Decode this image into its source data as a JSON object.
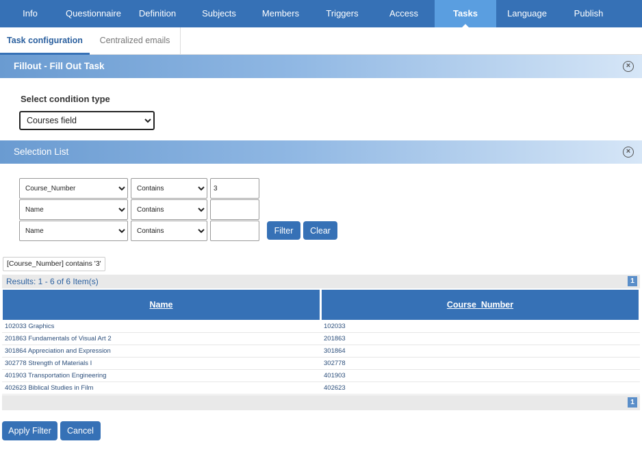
{
  "nav": {
    "items": [
      {
        "label": "Info"
      },
      {
        "label": "Questionnaire"
      },
      {
        "label": "Definition"
      },
      {
        "label": "Subjects"
      },
      {
        "label": "Members"
      },
      {
        "label": "Triggers"
      },
      {
        "label": "Access"
      },
      {
        "label": "Tasks"
      },
      {
        "label": "Language"
      },
      {
        "label": "Publish"
      }
    ],
    "active": "Tasks"
  },
  "subtabs": [
    {
      "label": "Task configuration"
    },
    {
      "label": "Centralized emails"
    }
  ],
  "fillout_section": {
    "title": "Fillout - Fill Out Task",
    "close_icon": "close-circle-icon"
  },
  "condition": {
    "label": "Select condition type",
    "value": "Courses field"
  },
  "selection_section": {
    "title": "Selection List",
    "close_icon": "close-circle-icon"
  },
  "filters": [
    {
      "field": "Course_Number",
      "operator": "Contains",
      "value": "3"
    },
    {
      "field": "Name",
      "operator": "Contains",
      "value": ""
    },
    {
      "field": "Name",
      "operator": "Contains",
      "value": ""
    }
  ],
  "buttons": {
    "filter": "Filter",
    "clear": "Clear",
    "apply_filter": "Apply Filter",
    "cancel": "Cancel"
  },
  "active_filter_tag": "[Course_Number] contains '3'",
  "results": {
    "summary": "Results: 1 - 6 of 6 Item(s)",
    "page": "1"
  },
  "grid": {
    "columns": [
      "Name",
      "Course_Number"
    ],
    "rows": [
      {
        "name": "102033 Graphics",
        "course_number": "102033"
      },
      {
        "name": "201863 Fundamentals of Visual Art 2",
        "course_number": "201863"
      },
      {
        "name": "301864 Appreciation and Expression",
        "course_number": "301864"
      },
      {
        "name": "302778 Strength of Materials I",
        "course_number": "302778"
      },
      {
        "name": "401903 Transportation Engineering",
        "course_number": "401903"
      },
      {
        "name": "402623 Biblical Studies in Film",
        "course_number": "402623"
      }
    ]
  },
  "colors": {
    "nav_bg": "#3671b6",
    "nav_active": "#5a9ee0",
    "button": "#3671b6",
    "link": "#2a5f9e"
  }
}
